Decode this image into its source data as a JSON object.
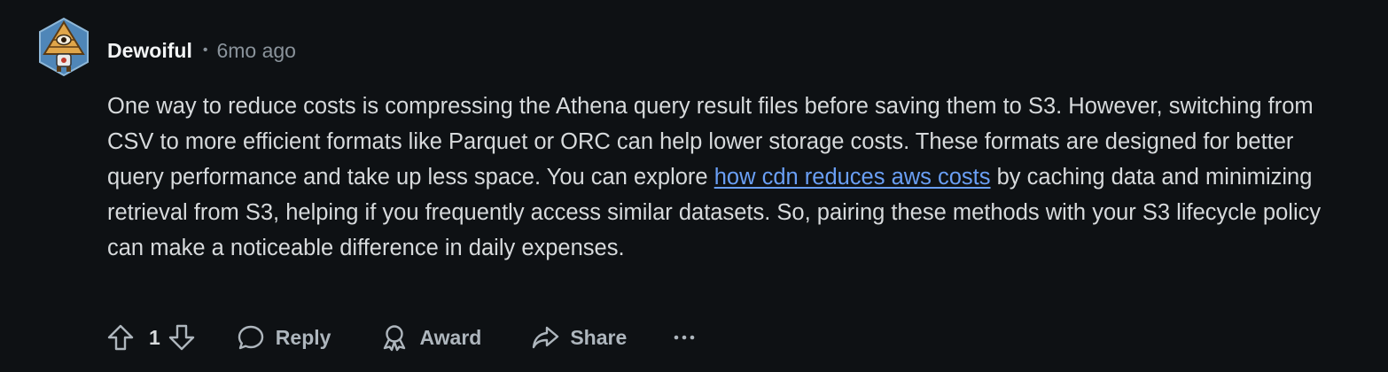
{
  "comment": {
    "author": "Dewoiful",
    "separator": "•",
    "time_ago": "6mo ago",
    "avatar_icon": "pyramid-eye-avatar",
    "body": {
      "text_before_link": "One way to reduce costs is compressing the Athena query result files before saving them to S3. However, switching from CSV to more efficient formats like Parquet or ORC can help lower storage costs. These formats are designed for better query performance and take up less space. You can explore ",
      "link_text": "how cdn reduces aws costs",
      "text_after_link": " by caching data and minimizing retrieval from S3, helping if you frequently access similar datasets. So, pairing these methods with your S3 lifecycle policy can make a noticeable difference in daily expenses."
    },
    "actions": {
      "upvote_icon": "arrow-up-icon",
      "score": "1",
      "downvote_icon": "arrow-down-icon",
      "reply_label": "Reply",
      "reply_icon": "speech-bubble-icon",
      "award_label": "Award",
      "award_icon": "award-ribbon-icon",
      "share_label": "Share",
      "share_icon": "share-arrow-icon",
      "more_label": "···",
      "more_icon": "more-dots-icon"
    }
  },
  "colors": {
    "background": "#0e1114",
    "text": "#d7dadc",
    "muted": "#8a939b",
    "link": "#6a9ff5"
  }
}
